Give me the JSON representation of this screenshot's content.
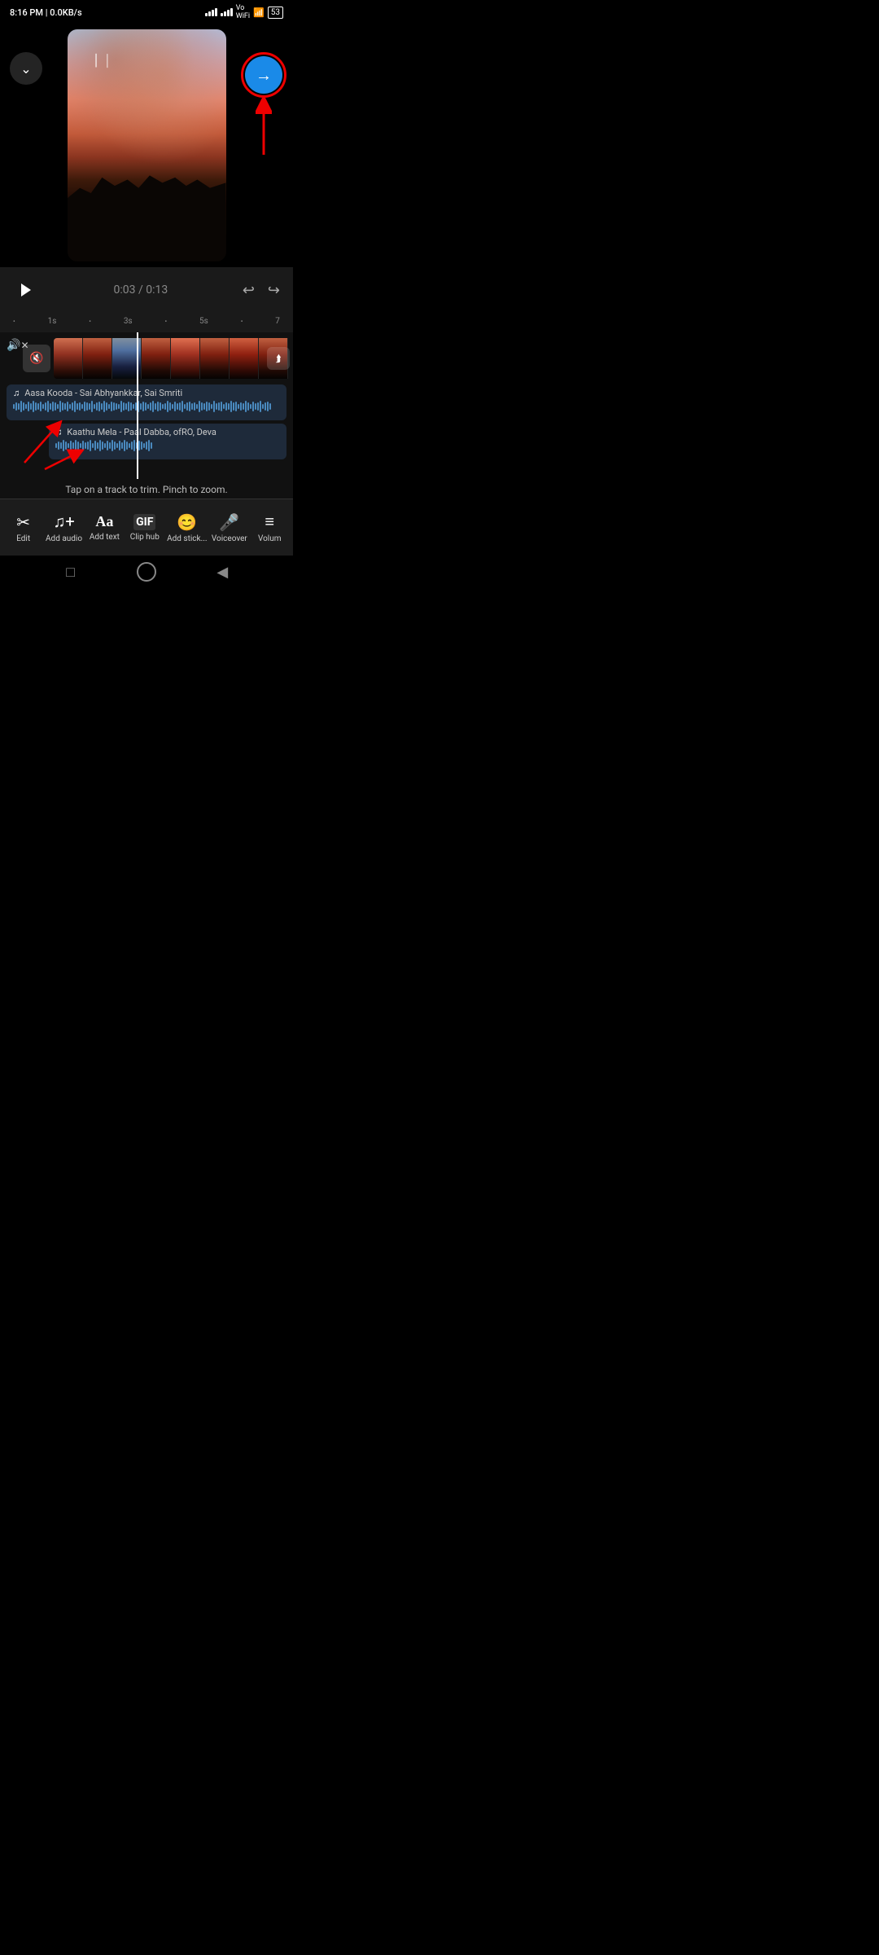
{
  "status_bar": {
    "time": "8:16 PM | 0.0KB/s",
    "network_icon": "✕",
    "battery": "53"
  },
  "header": {
    "back_label": "↓",
    "next_label": "→"
  },
  "controls": {
    "time_current": "0:03",
    "time_total": "0:13",
    "time_display": "0:03 / 0:13"
  },
  "ruler": {
    "marks": [
      "•",
      "1s",
      "•",
      "3s",
      "•",
      "5s",
      "•",
      "7"
    ]
  },
  "tracks": {
    "audio_track_1_name": "Aasa Kooda - Sai Abhyankkar, Sai Smriti",
    "audio_track_2_name": "Kaathu Mela - Paal Dabba, ofRO, Deva"
  },
  "hint": {
    "text": "Tap on a track to trim. Pinch to zoom."
  },
  "toolbar": {
    "items": [
      {
        "icon": "✂",
        "label": "Edit"
      },
      {
        "icon": "♪+",
        "label": "Add audio"
      },
      {
        "icon": "Aa",
        "label": "Add text"
      },
      {
        "icon": "GIF",
        "label": "Clip hub"
      },
      {
        "icon": "😊+",
        "label": "Add stick..."
      },
      {
        "icon": "🎙",
        "label": "Voiceover"
      },
      {
        "icon": "≡",
        "label": "Volum"
      }
    ]
  },
  "nav": {
    "square_icon": "■",
    "circle_icon": "●",
    "back_icon": "◀"
  }
}
